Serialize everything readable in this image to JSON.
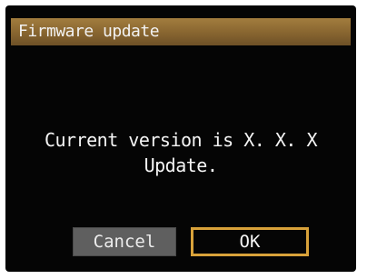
{
  "dialog": {
    "title": "Firmware update",
    "message_line1": "Current version is X. X. X",
    "message_line2": "Update."
  },
  "buttons": {
    "cancel_label": "Cancel",
    "ok_label": "OK",
    "selected": "OK"
  },
  "colors": {
    "screen_background": "#050505",
    "title_bar": "#8a6731",
    "selection_border": "#d9a23a",
    "cancel_button": "#5f5f5f",
    "text": "#f5f5f5"
  }
}
